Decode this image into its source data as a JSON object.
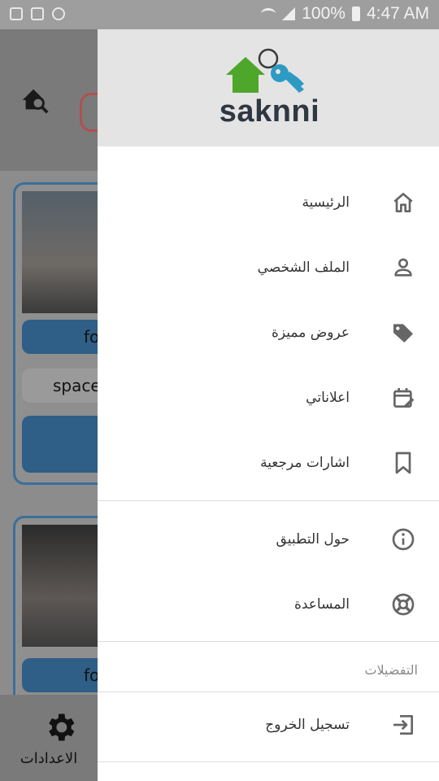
{
  "status_bar": {
    "battery": "100%",
    "time": "4:47 AM"
  },
  "background": {
    "card1_buttons": [
      "fo",
      "space"
    ],
    "card2_button": "for",
    "settings_label": "الاعدادات"
  },
  "drawer": {
    "brand": "saknni",
    "items": [
      {
        "label": "الرئيسية",
        "icon": "home-icon"
      },
      {
        "label": "الملف الشخصي",
        "icon": "person-icon"
      },
      {
        "label": "عروض مميزة",
        "icon": "tag-icon"
      },
      {
        "label": "اعلاناتي",
        "icon": "calendar-edit-icon"
      },
      {
        "label": "اشارات مرجعية",
        "icon": "bookmark-icon"
      },
      {
        "label": "حول التطبيق",
        "icon": "info-icon"
      },
      {
        "label": "المساعدة",
        "icon": "lifebuoy-icon"
      }
    ],
    "preferences_title": "التفضيلات",
    "logout_label": "تسجيل الخروج",
    "logout_icon": "logout-icon"
  },
  "colors": {
    "brand_green": "#4ea72a",
    "brand_blue": "#2d9ac4",
    "drawer_header": "#e4e4e4",
    "icon_color": "#666666"
  }
}
